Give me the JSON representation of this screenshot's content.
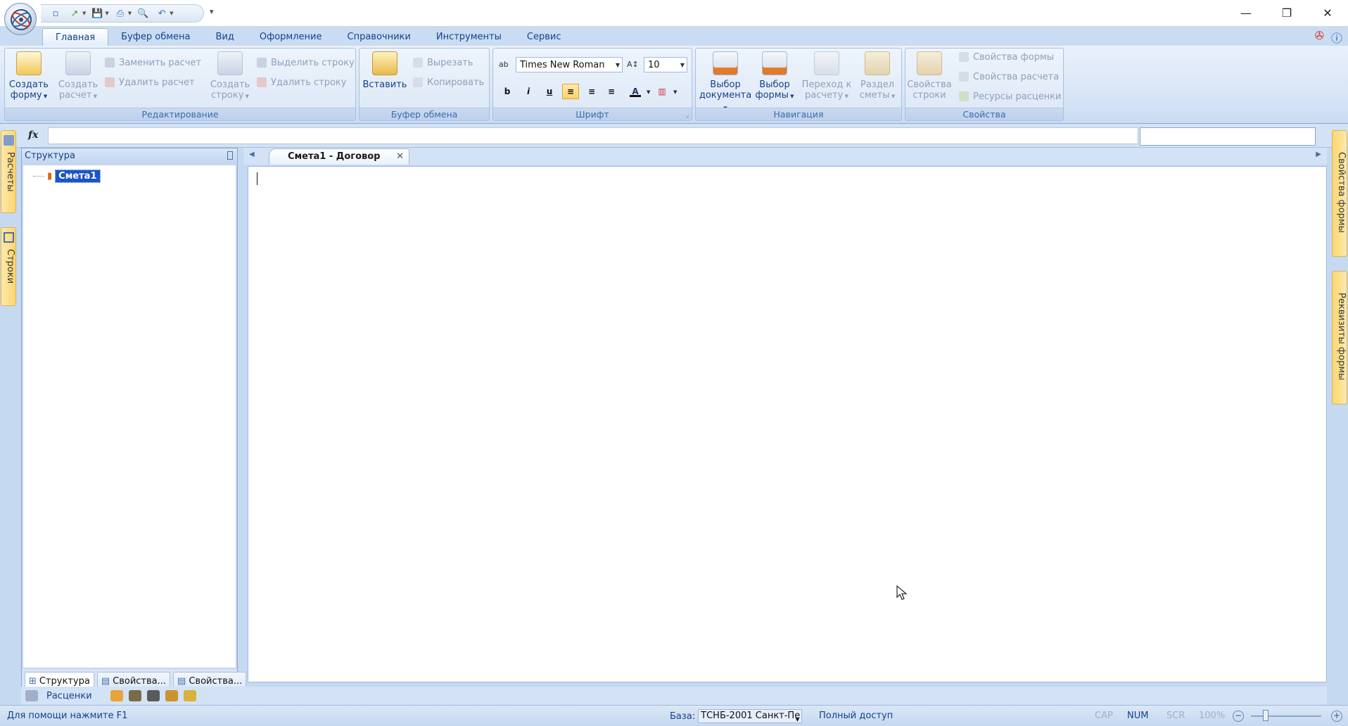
{
  "qat": {
    "icons": [
      "new-icon",
      "open-icon",
      "save-icon",
      "print-icon",
      "preview-icon",
      "undo-icon"
    ]
  },
  "window": {
    "minimize": "—",
    "restore": "❐",
    "close": "✕"
  },
  "ribbon_tabs": [
    "Главная",
    "Буфер обмена",
    "Вид",
    "Оформление",
    "Справочники",
    "Инструменты",
    "Сервис"
  ],
  "groups": {
    "editing": {
      "label": "Редактирование",
      "create_form": [
        "Создать",
        "форму"
      ],
      "create_calc": [
        "Создать",
        "расчет"
      ],
      "replace_calc": "Заменить расчет",
      "delete_calc": "Удалить расчет",
      "create_row": [
        "Создать",
        "строку"
      ],
      "select_row": "Выделить строку",
      "delete_row": "Удалить строку"
    },
    "clipboard": {
      "label": "Буфер обмена",
      "paste": "Вставить",
      "cut": "Вырезать",
      "copy": "Копировать"
    },
    "font": {
      "label": "Шрифт",
      "family": "Times New Roman",
      "size": "10",
      "bold": "b",
      "italic": "i",
      "underline": "u"
    },
    "navigation": {
      "label": "Навигация",
      "select_doc": [
        "Выбор",
        "документа"
      ],
      "select_form": [
        "Выбор",
        "формы"
      ],
      "goto_calc": [
        "Переход к",
        "расчету"
      ],
      "section": [
        "Раздел",
        "сметы"
      ]
    },
    "properties": {
      "label": "Свойства",
      "row_props": [
        "Свойства",
        "строки"
      ],
      "form_props": "Свойства формы",
      "calc_props": "Свойства расчета",
      "rate_resources": "Ресурсы расценки"
    }
  },
  "formula": {
    "fx": "fx"
  },
  "left_vtabs": [
    "Расчеты",
    "Строки"
  ],
  "right_vtabs": [
    "Свойства формы",
    "Реквизиты формы"
  ],
  "structure": {
    "title": "Структура",
    "node": "Смета1",
    "tabs": [
      "Структура",
      "Свойства...",
      "Свойства..."
    ]
  },
  "document": {
    "tab_title": "Смета1 - Договор",
    "close": "✕"
  },
  "bottom": {
    "label": "Расценки"
  },
  "status": {
    "help": "Для помощи нажмите F1",
    "base_label": "База:",
    "base_value": "ТСНБ-2001 Санкт-Пе",
    "access": "Полный доступ",
    "cap": "CAP",
    "num": "NUM",
    "scr": "SCR",
    "zoom": "100%"
  },
  "colors": {
    "accent": "#15428b",
    "selection": "#1c54c8",
    "ribbon": "#dbe7f6"
  }
}
